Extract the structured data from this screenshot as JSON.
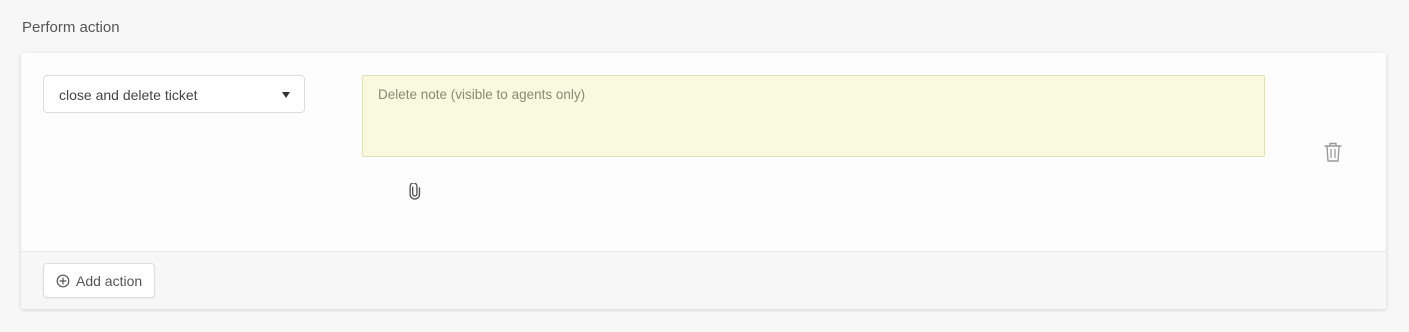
{
  "section": {
    "title": "Perform action"
  },
  "action": {
    "selected_action": "close and delete ticket",
    "note_placeholder": "Delete note (visible to agents only)",
    "attach_icon": "paperclip-icon",
    "delete_icon": "trash-icon"
  },
  "footer": {
    "add_action_label": "Add action",
    "add_icon": "plus-circle-icon"
  },
  "colors": {
    "note_background": "#f8f9df",
    "icon_gray": "#9a9a9a"
  }
}
